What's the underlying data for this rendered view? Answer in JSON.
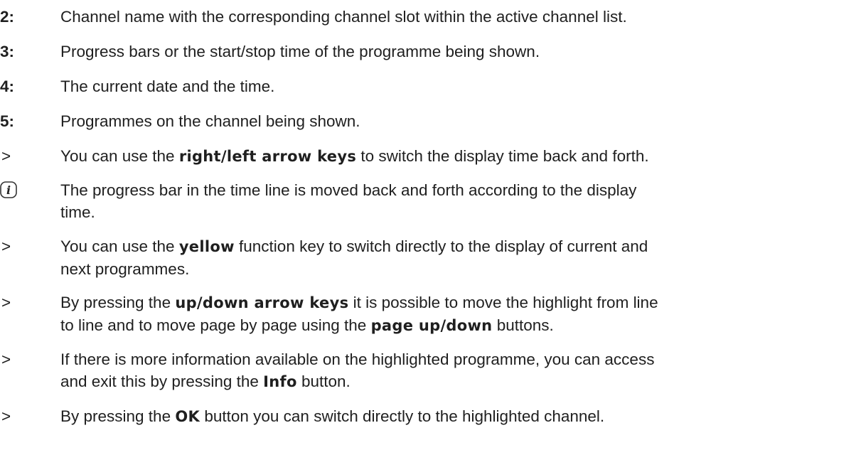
{
  "items": [
    {
      "marker": "2:",
      "text": "Channel name with the corresponding channel slot within the active channel list."
    },
    {
      "marker": "3:",
      "text": "Progress bars or the start/stop time of the programme being shown."
    },
    {
      "marker": "4:",
      "text": "The current date and the time."
    },
    {
      "marker": "5:",
      "text": "Programmes on the channel being shown."
    },
    {
      "marker": ">",
      "before": "You can use the ",
      "keyword": "right/left arrow keys",
      "after": " to switch the display time back and forth."
    },
    {
      "icon": "info-icon",
      "line1": "The progress bar in the time line is moved back and forth according to the display",
      "line2": "time."
    },
    {
      "marker": ">",
      "before": "You can use the ",
      "keyword": "yellow",
      "after": " function key to switch directly to the display of current and",
      "line2": "next programmes."
    },
    {
      "marker": ">",
      "before": "By pressing the ",
      "keyword": "up/down arrow keys",
      "after": " it is possible to move the highlight from line",
      "line2_before": "to line and to move page by page using the ",
      "line2_keyword": "page up/down",
      "line2_after": " buttons."
    },
    {
      "marker": ">",
      "text": "If there is more information available on the highlighted programme, you can access",
      "line2_before": "and exit this by pressing the ",
      "line2_keyword": "Info",
      "line2_after": " button."
    },
    {
      "marker": ">",
      "before": "By pressing the ",
      "keyword": "OK",
      "after": " button you can switch directly to the highlighted channel."
    }
  ]
}
